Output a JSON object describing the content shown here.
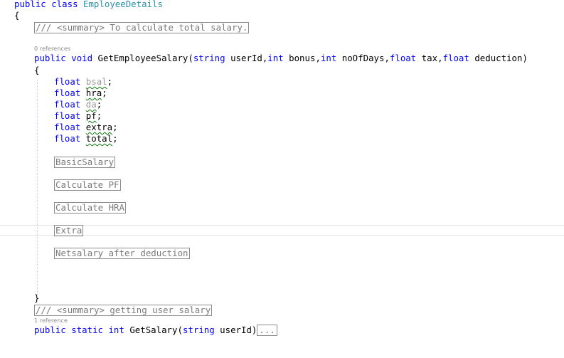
{
  "editor": {
    "class_decl": {
      "kw_public": "public",
      "kw_class": "class",
      "class_name": "EmployeeDetails"
    },
    "open_brace": "{",
    "summary_1": "/// <summary> To calculate total salary.",
    "codelens_1": "0 references",
    "method_1": {
      "kw_public": "public",
      "kw_void": "void",
      "name": "GetEmployeeSalary(",
      "t_string": "string",
      "p_userId": "userId,",
      "t_int1": "int",
      "p_bonus": "bonus,",
      "t_int2": "int",
      "p_noOfDays": "noOfDays,",
      "t_float1": "float",
      "p_tax": "tax,",
      "t_float2": "float",
      "p_deduction": "deduction)"
    },
    "method_open_brace": "{",
    "declarations": [
      {
        "kw": "float",
        "name": "bsal",
        "end": ";"
      },
      {
        "kw": "float",
        "name": "hra",
        "end": ";"
      },
      {
        "kw": "float",
        "name": "da",
        "end": ";"
      },
      {
        "kw": "float",
        "name": "pf",
        "end": ";"
      },
      {
        "kw": "float",
        "name": "extra",
        "end": ";"
      },
      {
        "kw": "float",
        "name": "total",
        "end": ";"
      }
    ],
    "regions": [
      "BasicSalary",
      "Calculate PF",
      "Calculate HRA",
      "Extra",
      "Netsalary after deduction"
    ],
    "method_close_brace": "}",
    "summary_2": "/// <summary> getting user salary",
    "codelens_2": "1 reference",
    "method_2": {
      "kw_public": "public",
      "kw_static": "static",
      "kw_int": "int",
      "name": "GetSalary(",
      "t_string": "string",
      "p_userId": "userId)",
      "collapsed": "..."
    }
  },
  "colors": {
    "keyword": "#0000ff",
    "type": "#2b91af",
    "collapsed_border": "#8c8c8c",
    "squiggle": "#0f7c0f"
  }
}
